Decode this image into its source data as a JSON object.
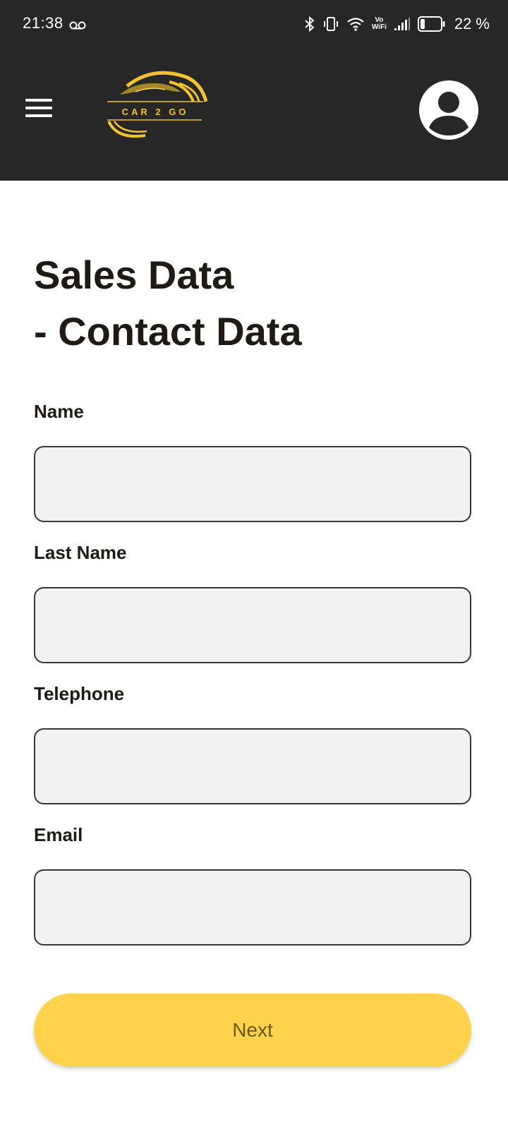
{
  "status_bar": {
    "time": "21:38",
    "icons": [
      "voicemail-icon",
      "bluetooth-icon",
      "vibrate-icon",
      "wifi-icon",
      "vowifi-icon",
      "signal-icon",
      "battery-icon"
    ],
    "vowifi_top": "Vo",
    "vowifi_bottom": "WiFi",
    "battery_percent": "22 %",
    "battery_level": 0.22
  },
  "app_bar": {
    "background": "#272727",
    "logo_text": "CAR 2 GO",
    "logo_color": "#f2c230",
    "icons": [
      "menu-icon",
      "profile-icon"
    ]
  },
  "form": {
    "title_line1": "Sales Data",
    "title_line2": "- Contact Data",
    "fields": [
      {
        "label": "Name",
        "value": "",
        "placeholder": ""
      },
      {
        "label": "Last Name",
        "value": "",
        "placeholder": ""
      },
      {
        "label": "Telephone",
        "value": "",
        "placeholder": ""
      },
      {
        "label": "Email",
        "value": "",
        "placeholder": ""
      }
    ],
    "next_label": "Next",
    "accent": "#fed24a"
  }
}
